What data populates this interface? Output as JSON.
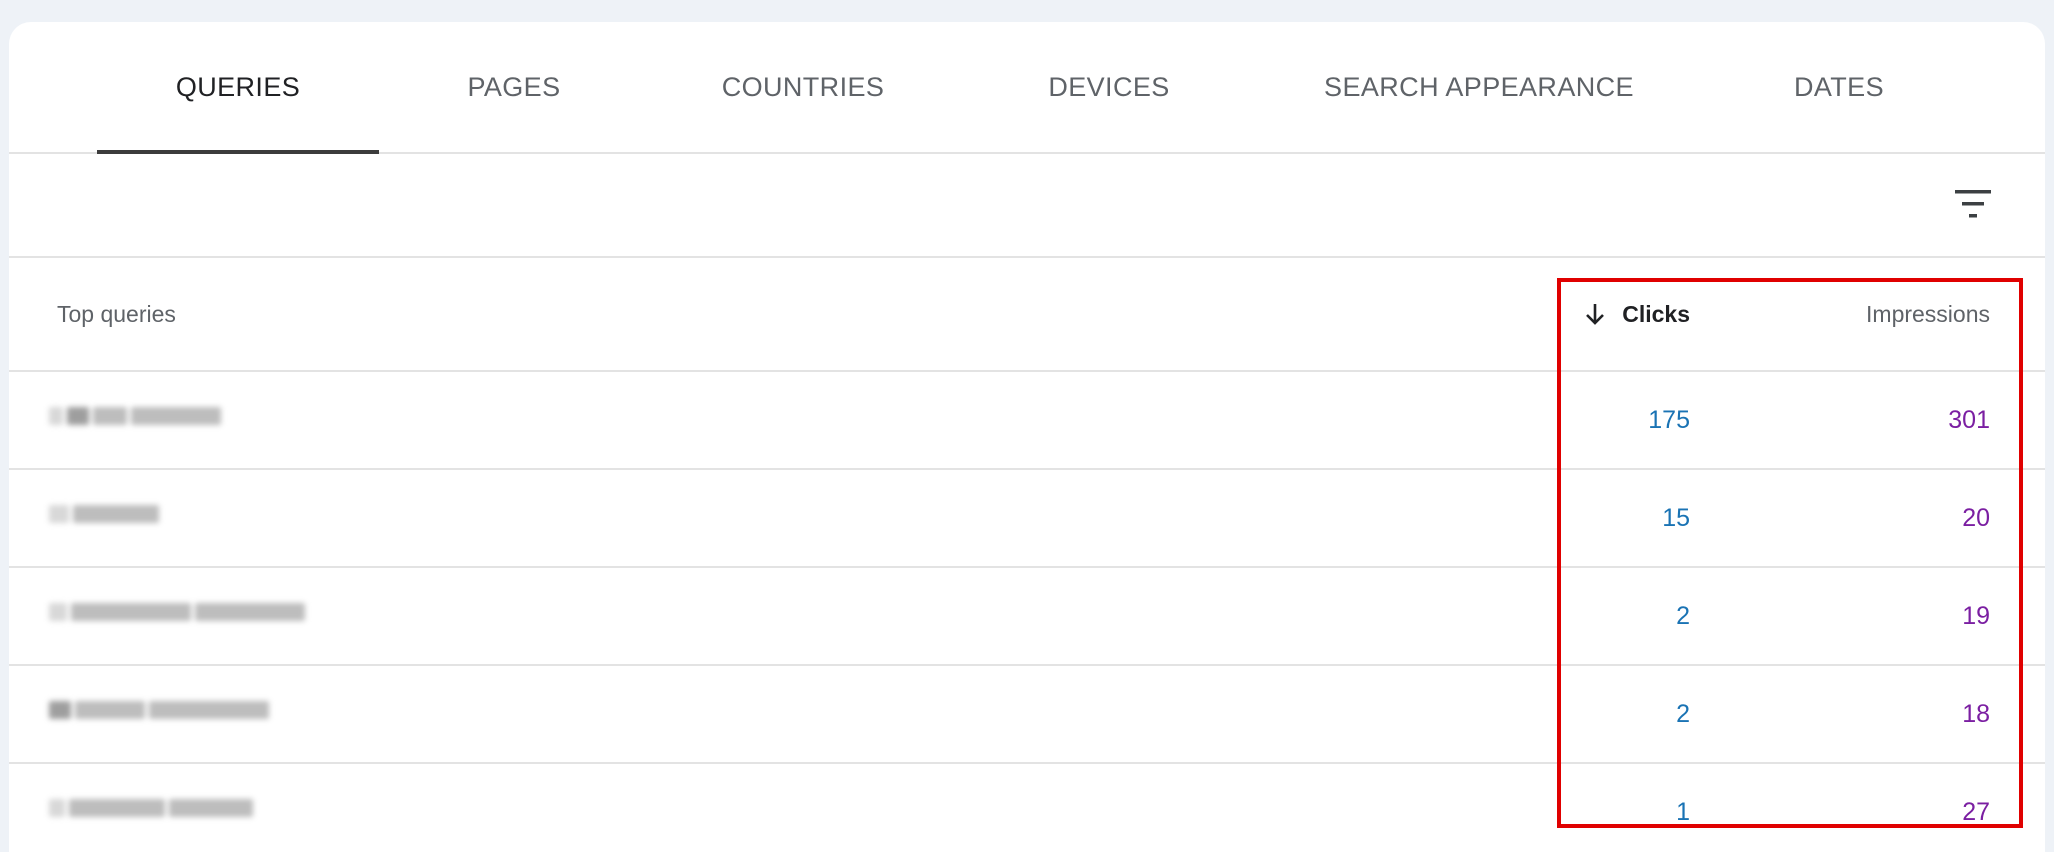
{
  "tabs": [
    {
      "label": "QUERIES",
      "active": true
    },
    {
      "label": "PAGES",
      "active": false
    },
    {
      "label": "COUNTRIES",
      "active": false
    },
    {
      "label": "DEVICES",
      "active": false
    },
    {
      "label": "SEARCH APPEARANCE",
      "active": false
    },
    {
      "label": "DATES",
      "active": false
    }
  ],
  "filter": {
    "icon": "filter-icon"
  },
  "table": {
    "headers": {
      "query": "Top queries",
      "clicks": "Clicks",
      "impressions": "Impressions"
    },
    "sort": {
      "column": "clicks",
      "direction": "descending",
      "icon": "arrow-down-icon"
    },
    "rows": [
      {
        "clicks": "175",
        "impressions": "301"
      },
      {
        "clicks": "15",
        "impressions": "20"
      },
      {
        "clicks": "2",
        "impressions": "19"
      },
      {
        "clicks": "2",
        "impressions": "18"
      },
      {
        "clicks": "1",
        "impressions": "27"
      }
    ]
  },
  "colors": {
    "clicks": "#1a73b4",
    "impressions": "#7b1fa2",
    "highlight": "#e00000"
  }
}
